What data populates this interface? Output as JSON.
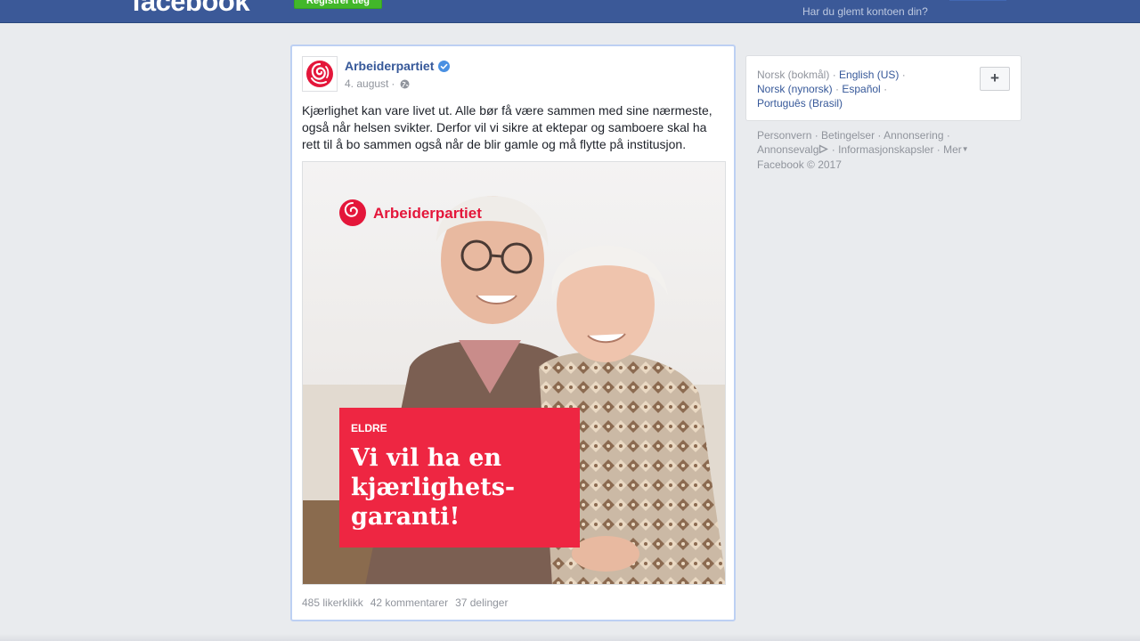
{
  "header": {
    "logo_text": "facebook",
    "register_label": "Registrer deg",
    "forgot_account": "Har du glemt kontoen din?"
  },
  "post": {
    "page_name": "Arbeiderpartiet",
    "date": "4. august",
    "separator": "·",
    "text": "Kjærlighet kan vare livet ut. Alle bør få være sammen med sine nærmeste, også når helsen svikter. Derfor vil vi sikre at ektepar og samboere skal ha rett til å bo sammen også når de blir gamle og må flytte på institusjon.",
    "image": {
      "brand": "Arbeiderpartiet",
      "tag": "ELDRE",
      "headline_1": "Vi vil ha en",
      "headline_2": "kjærlighets-",
      "headline_3": "garanti!"
    },
    "likes": "485 likerklikk",
    "comments": "42 kommentarer",
    "shares": "37 delinger"
  },
  "languages": {
    "current": "Norsk (bokmål)",
    "items": [
      "English (US)",
      "Norsk (nynorsk)",
      "Español",
      "Português (Brasil)"
    ],
    "add_label": "+"
  },
  "footer": {
    "links": [
      "Personvern",
      "Betingelser",
      "Annonsering",
      "Annonsevalg",
      "Informasjonskapsler",
      "Mer"
    ],
    "copyright": "Facebook © 2017"
  },
  "colors": {
    "brand_blue": "#3b5998",
    "link_blue": "#365899",
    "party_red": "#e4163a",
    "register_green": "#42b72a"
  }
}
